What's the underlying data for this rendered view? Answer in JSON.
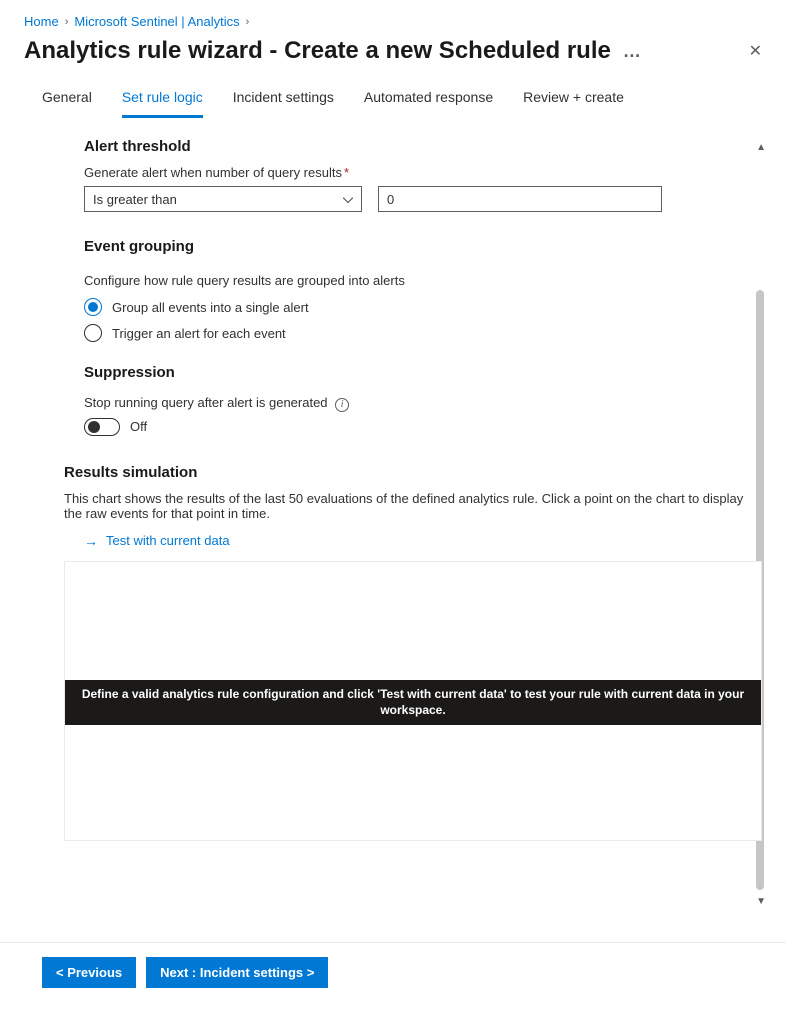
{
  "breadcrumb": {
    "items": [
      {
        "label": "Home"
      },
      {
        "label": "Microsoft Sentinel | Analytics"
      }
    ]
  },
  "title": "Analytics rule wizard - Create a new Scheduled rule",
  "tabs": [
    {
      "label": "General"
    },
    {
      "label": "Set rule logic",
      "active": true
    },
    {
      "label": "Incident settings"
    },
    {
      "label": "Automated response"
    },
    {
      "label": "Review + create"
    }
  ],
  "alert_threshold": {
    "heading": "Alert threshold",
    "field_label": "Generate alert when number of query results",
    "operator": "Is greater than",
    "value": "0"
  },
  "event_grouping": {
    "heading": "Event grouping",
    "description": "Configure how rule query results are grouped into alerts",
    "options": [
      {
        "label": "Group all events into a single alert",
        "selected": true
      },
      {
        "label": "Trigger an alert for each event",
        "selected": false
      }
    ]
  },
  "suppression": {
    "heading": "Suppression",
    "label": "Stop running query after alert is generated",
    "toggle_state": "Off"
  },
  "results_sim": {
    "heading": "Results simulation",
    "description": "This chart shows the results of the last 50 evaluations of the defined analytics rule. Click a point on the chart to display the raw events for that point in time.",
    "link": "Test with current data",
    "banner": "Define a valid analytics rule configuration and click 'Test with current data' to test your rule with current data in your workspace."
  },
  "footer": {
    "prev": "< Previous",
    "next": "Next : Incident settings >"
  }
}
